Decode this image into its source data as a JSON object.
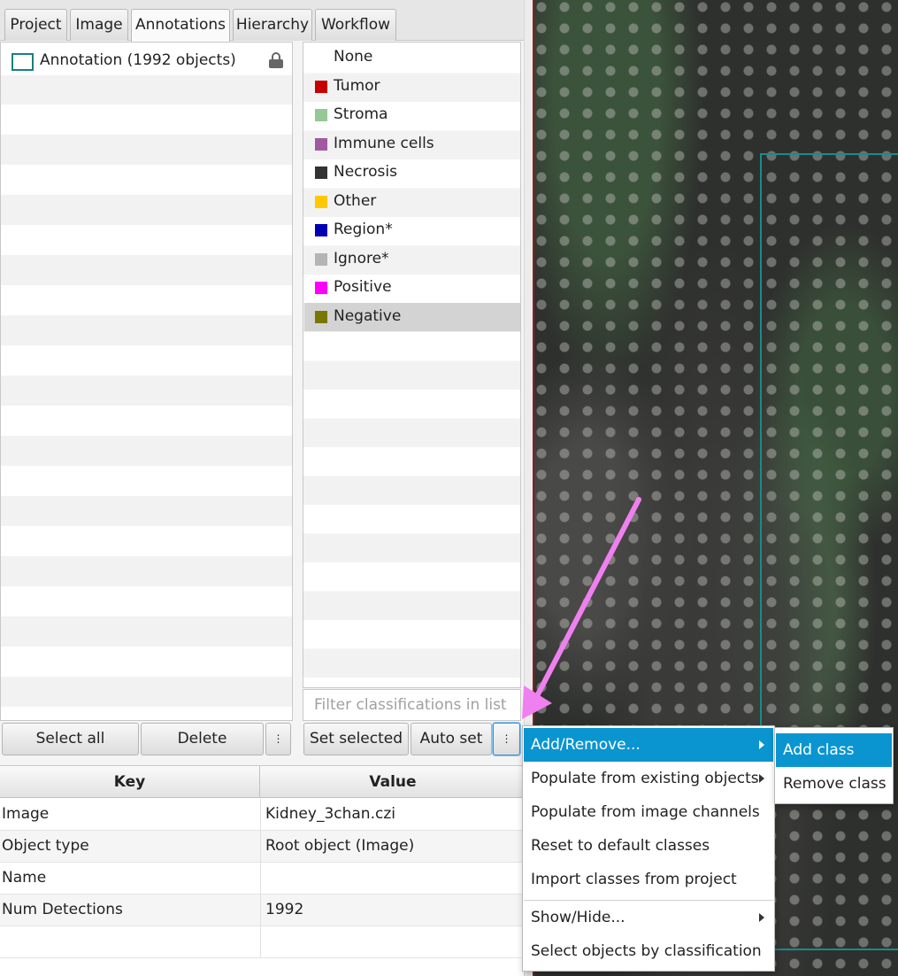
{
  "tabs": [
    {
      "label": "Project"
    },
    {
      "label": "Image"
    },
    {
      "label": "Annotations"
    },
    {
      "label": "Hierarchy"
    },
    {
      "label": "Workflow"
    }
  ],
  "active_tab": "Annotations",
  "annotation_list": {
    "items": [
      {
        "label": "Annotation (1992 objects)",
        "color": "#1a7f80",
        "locked": true
      }
    ]
  },
  "classifications": [
    {
      "label": "None",
      "color": null
    },
    {
      "label": "Tumor",
      "color": "#c80000"
    },
    {
      "label": "Stroma",
      "color": "#96c896"
    },
    {
      "label": "Immune cells",
      "color": "#a05aa0"
    },
    {
      "label": "Necrosis",
      "color": "#323232"
    },
    {
      "label": "Other",
      "color": "#ffc800"
    },
    {
      "label": "Region*",
      "color": "#0000b4"
    },
    {
      "label": "Ignore*",
      "color": "#b4b4b4"
    },
    {
      "label": "Positive",
      "color": "#ff00ff"
    },
    {
      "label": "Negative",
      "color": "#787800",
      "selected": true
    }
  ],
  "filter": {
    "placeholder": "Filter classifications in list"
  },
  "buttons": {
    "select_all": "Select all",
    "delete": "Delete",
    "more": "⋮",
    "set_selected": "Set selected",
    "auto_set": "Auto set",
    "class_more": "⋮"
  },
  "table": {
    "headers": {
      "key": "Key",
      "value": "Value"
    },
    "rows": [
      {
        "key": "Image",
        "value": "Kidney_3chan.czi"
      },
      {
        "key": "Object type",
        "value": "Root object (Image)"
      },
      {
        "key": "Name",
        "value": ""
      },
      {
        "key": "Num Detections",
        "value": "1992"
      }
    ]
  },
  "context_menu": {
    "items": [
      {
        "label": "Add/Remove...",
        "submenu": true,
        "highlighted": true
      },
      {
        "label": "Populate from existing objects",
        "submenu": true
      },
      {
        "label": "Populate from image channels"
      },
      {
        "label": "Reset to default classes"
      },
      {
        "label": "Import classes from project"
      },
      {
        "label": "Show/Hide...",
        "submenu": true
      },
      {
        "label": "Select objects by classification"
      }
    ],
    "submenu": [
      {
        "label": "Add class",
        "highlighted": true
      },
      {
        "label": "Remove class"
      }
    ]
  },
  "colors": {
    "accent": "#0a95d0",
    "annotation": "#1a7f80",
    "arrow": "#f080f0"
  }
}
